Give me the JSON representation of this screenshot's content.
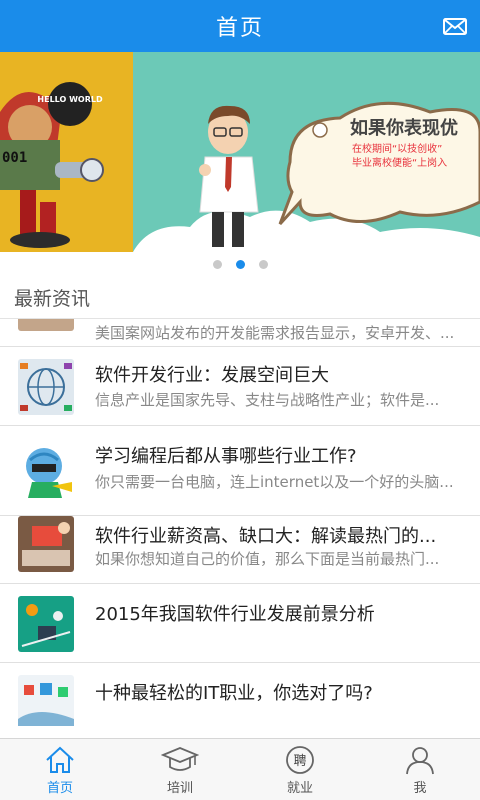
{
  "header": {
    "title": "首页"
  },
  "banner": {
    "bubble_robot": "HELLO WORLD",
    "shirt_text": "001",
    "headline": "如果你表现优",
    "line1": "在校期间“以技创收”",
    "line2": "毕业离校便能“上岗入"
  },
  "news": {
    "section_title": "最新资讯",
    "items": [
      {
        "title": "",
        "summary": "美国案网站发布的开发能需求报告显示，安卓开发、..."
      },
      {
        "title": "软件开发行业：发展空间巨大",
        "summary": "信息产业是国家先导、支柱与战略性产业；软件是..."
      },
      {
        "title": "学习编程后都从事哪些行业工作?",
        "summary": "你只需要一台电脑，连上internet以及一个好的头脑..."
      },
      {
        "title": "软件行业薪资高、缺口大：解读最热门的...",
        "summary": "如果你想知道自己的价值，那么下面是当前最热门..."
      },
      {
        "title": "2015年我国软件行业发展前景分析",
        "summary": ""
      },
      {
        "title": "十种最轻松的IT职业，你选对了吗?",
        "summary": ""
      }
    ]
  },
  "tabs": [
    {
      "label": "首页",
      "icon": "home-icon",
      "active": true
    },
    {
      "label": "培训",
      "icon": "graduation-cap-icon",
      "active": false
    },
    {
      "label": "就业",
      "icon": "hire-badge-icon",
      "active": false,
      "badge_text": "聘"
    },
    {
      "label": "我",
      "icon": "person-icon",
      "active": false
    }
  ],
  "colors": {
    "primary": "#1a8cea",
    "banner_bg": "#6cc9b7",
    "banner_left": "#e8b423"
  }
}
